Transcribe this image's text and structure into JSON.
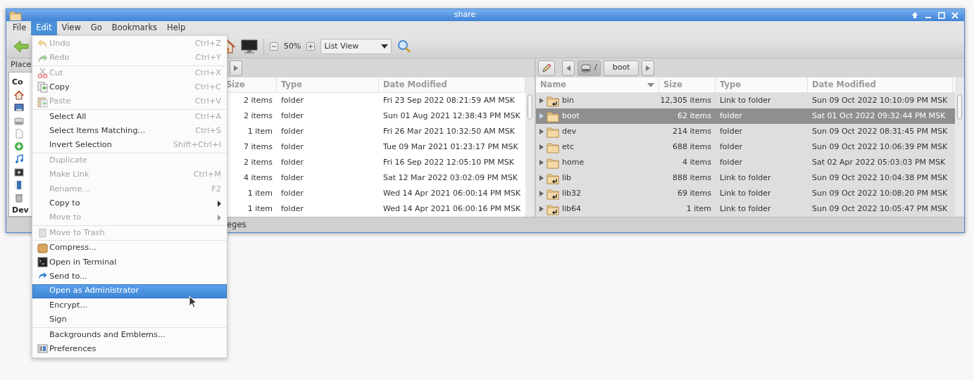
{
  "window": {
    "title": "share"
  },
  "menubar": [
    {
      "label": "File",
      "selected": false
    },
    {
      "label": "Edit",
      "selected": true
    },
    {
      "label": "View",
      "selected": false
    },
    {
      "label": "Go",
      "selected": false
    },
    {
      "label": "Bookmarks",
      "selected": false
    },
    {
      "label": "Help",
      "selected": false
    }
  ],
  "toolbar": {
    "zoom": "50%",
    "view": "List View"
  },
  "left_pane": {
    "places_label": "Place",
    "sidebar_headers": [
      "Co",
      "Dev"
    ],
    "columns": [
      "Size",
      "Type",
      "Date Modified"
    ],
    "rows": [
      {
        "size": "2 items",
        "type": "folder",
        "date": "Fri 23 Sep 2022 08:21:59 AM MSK"
      },
      {
        "size": "2 items",
        "type": "folder",
        "date": "Sun 01 Aug 2021 12:38:43 PM MSK"
      },
      {
        "size": "1 item",
        "type": "folder",
        "date": "Fri 26 Mar 2021 10:32:50 AM MSK"
      },
      {
        "size": "7 items",
        "type": "folder",
        "date": "Tue 09 Mar 2021 01:23:17 PM MSK"
      },
      {
        "size": "2 items",
        "type": "folder",
        "date": "Fri 16 Sep 2022 12:05:10 PM MSK"
      },
      {
        "size": "4 items",
        "type": "folder",
        "date": "Sat 12 Mar 2022 03:02:09 PM MSK"
      },
      {
        "size": "1 item",
        "type": "folder",
        "date": "Wed 14 Apr 2021 06:00:14 PM MSK"
      },
      {
        "size": "1 item",
        "type": "folder",
        "date": "Wed 14 Apr 2021 06:00:16 PM MSK"
      }
    ],
    "status": "eges"
  },
  "right_pane": {
    "path": [
      {
        "label": "/",
        "selected": true
      },
      {
        "label": "boot",
        "selected": false
      }
    ],
    "columns": [
      {
        "label": "Name",
        "sorted": true
      },
      {
        "label": "Size",
        "sorted": false
      },
      {
        "label": "Type",
        "sorted": false
      },
      {
        "label": "Date Modified",
        "sorted": false
      }
    ],
    "rows": [
      {
        "kind": "link",
        "name": "bin",
        "size": "12,305 items",
        "type": "Link to folder",
        "date": "Sun 09 Oct 2022 10:10:09 PM MSK",
        "selected": false
      },
      {
        "kind": "folder",
        "name": "boot",
        "size": "62 items",
        "type": "folder",
        "date": "Sat 01 Oct 2022 09:32:44 PM MSK",
        "selected": true
      },
      {
        "kind": "folder",
        "name": "dev",
        "size": "214 items",
        "type": "folder",
        "date": "Sun 09 Oct 2022 08:31:45 PM MSK",
        "selected": false
      },
      {
        "kind": "folder",
        "name": "etc",
        "size": "688 items",
        "type": "folder",
        "date": "Sun 09 Oct 2022 10:06:39 PM MSK",
        "selected": false
      },
      {
        "kind": "folder",
        "name": "home",
        "size": "4 items",
        "type": "folder",
        "date": "Sat 02 Apr 2022 05:03:03 PM MSK",
        "selected": false
      },
      {
        "kind": "link",
        "name": "lib",
        "size": "888 items",
        "type": "Link to folder",
        "date": "Sun 09 Oct 2022 10:04:38 PM MSK",
        "selected": false
      },
      {
        "kind": "link",
        "name": "lib32",
        "size": "69 items",
        "type": "Link to folder",
        "date": "Sun 09 Oct 2022 10:08:20 PM MSK",
        "selected": false
      },
      {
        "kind": "link",
        "name": "lib64",
        "size": "1 item",
        "type": "Link to folder",
        "date": "Sun 09 Oct 2022 10:05:47 PM MSK",
        "selected": false
      }
    ]
  },
  "edit_menu": {
    "sections": [
      [
        {
          "label": "Undo",
          "shortcut": "Ctrl+Z",
          "disabled": true,
          "submenu": false,
          "selected": false
        },
        {
          "label": "Redo",
          "shortcut": "Ctrl+Y",
          "disabled": true,
          "submenu": false,
          "selected": false
        }
      ],
      [
        {
          "label": "Cut",
          "shortcut": "Ctrl+X",
          "disabled": true,
          "submenu": false,
          "selected": false
        },
        {
          "label": "Copy",
          "shortcut": "Ctrl+C",
          "disabled": false,
          "submenu": false,
          "selected": false
        },
        {
          "label": "Paste",
          "shortcut": "Ctrl+V",
          "disabled": true,
          "submenu": false,
          "selected": false
        }
      ],
      [
        {
          "label": "Select All",
          "shortcut": "Ctrl+A",
          "disabled": false,
          "submenu": false,
          "selected": false
        },
        {
          "label": "Select Items Matching...",
          "shortcut": "Ctrl+S",
          "disabled": false,
          "submenu": false,
          "selected": false
        },
        {
          "label": "Invert Selection",
          "shortcut": "Shift+Ctrl+I",
          "disabled": false,
          "submenu": false,
          "selected": false
        }
      ],
      [
        {
          "label": "Duplicate",
          "disabled": true,
          "submenu": false,
          "selected": false
        },
        {
          "label": "Make Link",
          "shortcut": "Ctrl+M",
          "disabled": true,
          "submenu": false,
          "selected": false
        },
        {
          "label": "Rename...",
          "shortcut": "F2",
          "disabled": true,
          "submenu": false,
          "selected": false
        },
        {
          "label": "Copy to",
          "disabled": false,
          "submenu": true,
          "selected": false
        },
        {
          "label": "Move to",
          "disabled": true,
          "submenu": true,
          "selected": false
        }
      ],
      [
        {
          "label": "Move to Trash",
          "disabled": true,
          "submenu": false,
          "selected": false
        }
      ],
      [
        {
          "label": "Compress...",
          "disabled": false,
          "submenu": false,
          "selected": false
        },
        {
          "label": "Open in Terminal",
          "disabled": false,
          "submenu": false,
          "selected": false
        },
        {
          "label": "Send to...",
          "disabled": false,
          "submenu": false,
          "selected": false
        },
        {
          "label": "Open as Administrator",
          "disabled": false,
          "submenu": false,
          "selected": true
        },
        {
          "label": "Encrypt...",
          "disabled": false,
          "submenu": false,
          "selected": false
        },
        {
          "label": "Sign",
          "disabled": false,
          "submenu": false,
          "selected": false
        }
      ],
      [
        {
          "label": "Backgrounds and Emblems...",
          "disabled": false,
          "submenu": false,
          "selected": false
        },
        {
          "label": "Preferences",
          "disabled": false,
          "submenu": false,
          "selected": false
        }
      ]
    ]
  }
}
